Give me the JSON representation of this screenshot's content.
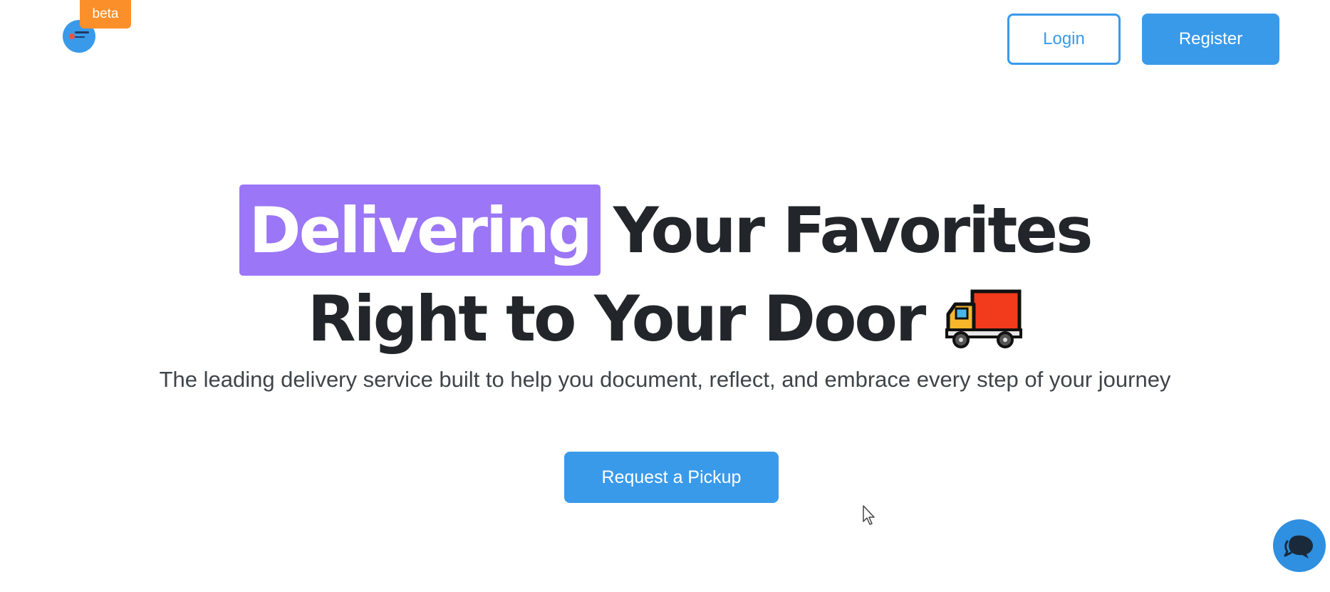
{
  "header": {
    "logo_icon": "brand-logo",
    "beta_badge": "beta",
    "login_label": "Login",
    "register_label": "Register"
  },
  "hero": {
    "highlight_word": "Delivering",
    "line1_rest": "Your Favorites",
    "line2": "Right to Your Door",
    "line2_icon": "delivery-truck-icon",
    "subtitle": "The leading delivery service built to help you document, reflect, and embrace every step of your journey",
    "cta_label": "Request a Pickup"
  },
  "chat": {
    "icon": "chat-bubbles-icon"
  },
  "colors": {
    "accent_blue": "#3a9aea",
    "highlight_purple": "#9b76f6",
    "beta_orange": "#fb8f2a",
    "heading": "#222529",
    "subtitle": "#3f4449"
  }
}
